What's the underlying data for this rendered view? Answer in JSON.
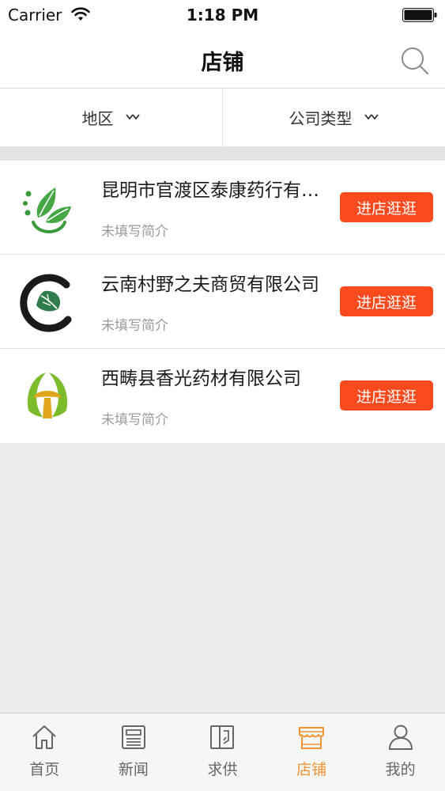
{
  "status": {
    "carrier": "Carrier",
    "time": "1:18 PM"
  },
  "nav": {
    "title": "店铺"
  },
  "filters": [
    {
      "label": "地区"
    },
    {
      "label": "公司类型"
    }
  ],
  "stores": [
    {
      "name": "昆明市官渡区泰康药行有限公司",
      "desc": "未填写简介",
      "button": "进店逛逛",
      "logo": "leaf-logo-icon"
    },
    {
      "name": "云南村野之夫商贸有限公司",
      "desc": "未填写简介",
      "button": "进店逛逛",
      "logo": "circle-leaf-logo-icon"
    },
    {
      "name": "西畴县香光药材有限公司",
      "desc": "未填写简介",
      "button": "进店逛逛",
      "logo": "mushroom-logo-icon"
    }
  ],
  "tabs": [
    {
      "label": "首页",
      "icon": "home-icon",
      "active": false
    },
    {
      "label": "新闻",
      "icon": "news-icon",
      "active": false
    },
    {
      "label": "求供",
      "icon": "supply-icon",
      "active": false
    },
    {
      "label": "店铺",
      "icon": "store-icon",
      "active": true
    },
    {
      "label": "我的",
      "icon": "profile-icon",
      "active": false
    }
  ],
  "colors": {
    "accent": "#f39232",
    "button": "#fb4a1d",
    "background": "#ecebed"
  }
}
